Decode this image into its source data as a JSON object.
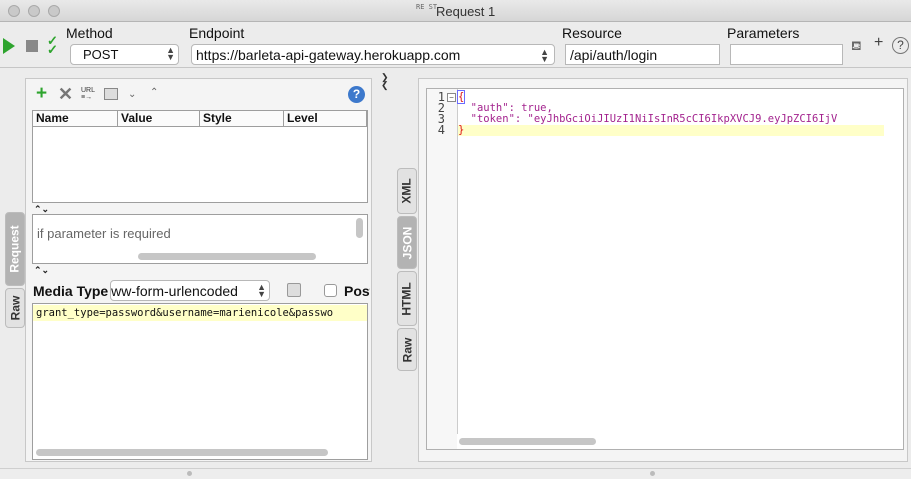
{
  "window": {
    "title": "Request 1",
    "icon_text": "RE ST"
  },
  "toolbar": {
    "method_label": "Method",
    "method_value": "POST",
    "endpoint_label": "Endpoint",
    "endpoint_value": "https://barleta-api-gateway.herokuapp.com",
    "resource_label": "Resource",
    "resource_value": "/api/auth/login",
    "parameters_label": "Parameters",
    "parameters_value": ""
  },
  "params_table": {
    "columns": [
      "Name",
      "Value",
      "Style",
      "Level"
    ]
  },
  "param_description": "if parameter is required",
  "media": {
    "label": "Media Type",
    "value": "www-form-urlencoded",
    "post_label": "Post"
  },
  "request_body": "grant_type=password&username=marienicole&passwo",
  "left_tabs": [
    "Request",
    "Raw"
  ],
  "response_tabs": [
    "XML",
    "JSON",
    "HTML",
    "Raw"
  ],
  "response": {
    "line_numbers": [
      "1",
      "2",
      "3",
      "4"
    ],
    "lines": [
      "{",
      "  \"auth\": true,",
      "  \"token\": \"eyJhbGciOiJIUzI1NiIsInR5cCI6IkpXVCJ9.eyJpZCI6IjV",
      "}"
    ]
  },
  "colors": {
    "green": "#2ea42e",
    "json_key": "#a3238e",
    "highlight": "#ffffc8",
    "brace": "#d11"
  }
}
